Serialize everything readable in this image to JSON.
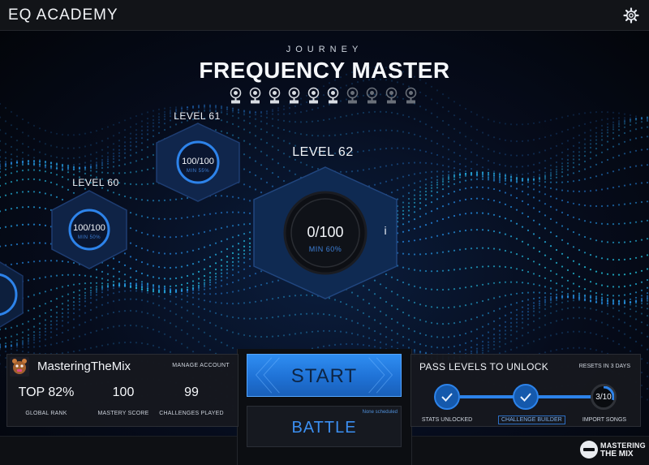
{
  "app": {
    "title": "EQ ACADEMY",
    "settings_icon": "gear-icon"
  },
  "journey": {
    "label": "JOURNEY",
    "title": "FREQUENCY MASTER",
    "trophies_total": 10,
    "trophies_earned": 6
  },
  "levels": [
    {
      "label": "LEVEL 60",
      "score": "100/100",
      "min": "MIN 50%",
      "progress": 1.0
    },
    {
      "label": "LEVEL 61",
      "score": "100/100",
      "min": "MIN 55%",
      "progress": 1.0
    },
    {
      "label": "LEVEL 62",
      "score": "0/100",
      "min": "MIN 60%",
      "progress": 0.0,
      "current": true
    }
  ],
  "info_button": "i",
  "profile": {
    "username": "MasteringTheMix",
    "manage": "MANAGE ACCOUNT",
    "stats": [
      {
        "value": "TOP 82%",
        "label": "GLOBAL RANK"
      },
      {
        "value": "100",
        "label": "MASTERY SCORE"
      },
      {
        "value": "99",
        "label": "CHALLENGES PLAYED"
      }
    ]
  },
  "actions": {
    "start": "START",
    "battle": "BATTLE",
    "battle_note": "None scheduled"
  },
  "unlock": {
    "title": "PASS LEVELS TO UNLOCK",
    "reset": "RESETS IN 3 DAYS",
    "items": [
      {
        "label": "STATS UNLOCKED",
        "status": "done"
      },
      {
        "label": "CHALLENGE BUILDER",
        "status": "done"
      },
      {
        "label": "IMPORT SONGS",
        "status": "current",
        "count": "3/10",
        "progress": 0.3
      }
    ]
  },
  "brand": {
    "top": "MASTERING",
    "bottom": "THE MIX"
  },
  "colors": {
    "accent": "#2d83ea",
    "background": "#05070c",
    "panel": "#16181e"
  }
}
